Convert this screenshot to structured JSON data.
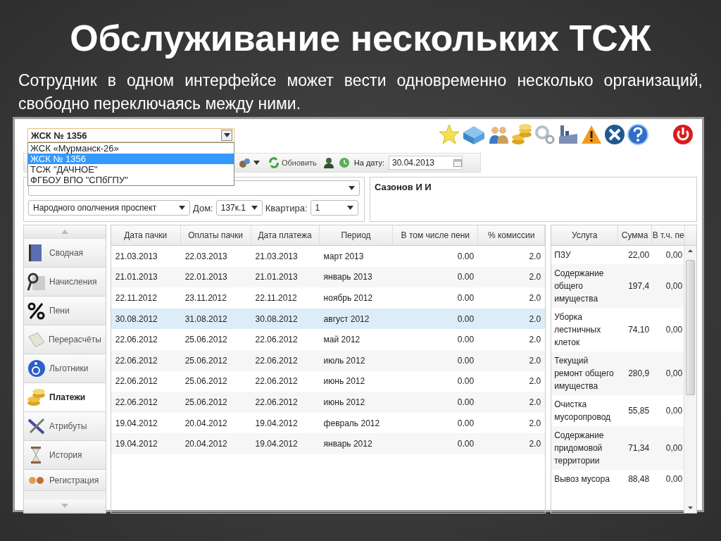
{
  "slide": {
    "title": "Обслуживание нескольких ТСЖ",
    "subtitle": "Сотрудник в одном интерфейсе может вести одновременно несколько организаций, свободно переключаясь между ними."
  },
  "org_select": {
    "value": "ЖСК № 1356",
    "expanded": true,
    "options": [
      {
        "label": "ЖСК «Мурманск-26»",
        "selected": false
      },
      {
        "label": "ЖСК № 1356",
        "selected": true
      },
      {
        "label": "ТСЖ \"ДАЧНОЕ\"",
        "selected": false
      },
      {
        "label": "ФГБОУ ВПО \"СПбГПУ\"",
        "selected": false
      }
    ]
  },
  "toolbar": {
    "refresh_label": "Обновить",
    "date_label": "На дату:",
    "date_value": "30.04.2013"
  },
  "address": {
    "street": "Народного ополчения проспект",
    "house_label": "Дом:",
    "house": "137к.1",
    "flat_label": "Квартира:",
    "flat": "1",
    "resident": "Сазонов И И"
  },
  "sidebar": {
    "items": [
      {
        "label": "Сводная",
        "selected": false
      },
      {
        "label": "Начисления",
        "selected": false
      },
      {
        "label": "Пени",
        "selected": false
      },
      {
        "label": "Перерасчёты",
        "selected": false
      },
      {
        "label": "Льготники",
        "selected": false
      },
      {
        "label": "Платежи",
        "selected": true
      },
      {
        "label": "Атрибуты",
        "selected": false
      },
      {
        "label": "История",
        "selected": false
      },
      {
        "label": "Регистрация",
        "selected": false
      }
    ]
  },
  "payments": {
    "columns": [
      "Дата пачки",
      "Оплаты пачки",
      "Дата платежа",
      "Период",
      "В том числе пени",
      "% комиссии"
    ],
    "rows": [
      {
        "cells": [
          "21.03.2013",
          "22.03.2013",
          "21.03.2013",
          "март 2013",
          "0.00",
          "2.0"
        ],
        "selected": false
      },
      {
        "cells": [
          "21.01.2013",
          "22.01.2013",
          "21.01.2013",
          "январь 2013",
          "0.00",
          "2.0"
        ],
        "selected": false
      },
      {
        "cells": [
          "22.11.2012",
          "23.11.2012",
          "22.11.2012",
          "ноябрь 2012",
          "0.00",
          "2.0"
        ],
        "selected": false
      },
      {
        "cells": [
          "30.08.2012",
          "31.08.2012",
          "30.08.2012",
          "август 2012",
          "0.00",
          "2.0"
        ],
        "selected": true
      },
      {
        "cells": [
          "22.06.2012",
          "25.06.2012",
          "22.06.2012",
          "май 2012",
          "0.00",
          "2.0"
        ],
        "selected": false
      },
      {
        "cells": [
          "22.06.2012",
          "25.06.2012",
          "22.06.2012",
          "июль 2012",
          "0.00",
          "2.0"
        ],
        "selected": false
      },
      {
        "cells": [
          "22.06.2012",
          "25.06.2012",
          "22.06.2012",
          "июнь 2012",
          "0.00",
          "2.0"
        ],
        "selected": false
      },
      {
        "cells": [
          "22.06.2012",
          "25.06.2012",
          "22.06.2012",
          "июнь 2012",
          "0.00",
          "2.0"
        ],
        "selected": false
      },
      {
        "cells": [
          "19.04.2012",
          "20.04.2012",
          "19.04.2012",
          "февраль 2012",
          "0.00",
          "2.0"
        ],
        "selected": false
      },
      {
        "cells": [
          "19.04.2012",
          "20.04.2012",
          "19.04.2012",
          "январь 2012",
          "0.00",
          "2.0"
        ],
        "selected": false
      }
    ]
  },
  "services": {
    "columns": [
      "Услуга",
      "Сумма",
      "В т.ч. пе"
    ],
    "rows": [
      [
        "ПЗУ",
        "22,00",
        "0,00"
      ],
      [
        "Содержание общего имущества",
        "197,4",
        "0,00"
      ],
      [
        "Уборка лестничных клеток",
        "74,10",
        "0,00"
      ],
      [
        "Текущий ремонт общего имущества",
        "280,9",
        "0,00"
      ],
      [
        "Очистка мусоропровод",
        "55,85",
        "0,00"
      ],
      [
        "Содержание придомовой территории",
        "71,34",
        "0,00"
      ],
      [
        "Вывоз мусора",
        "88,48",
        "0,00"
      ]
    ]
  }
}
